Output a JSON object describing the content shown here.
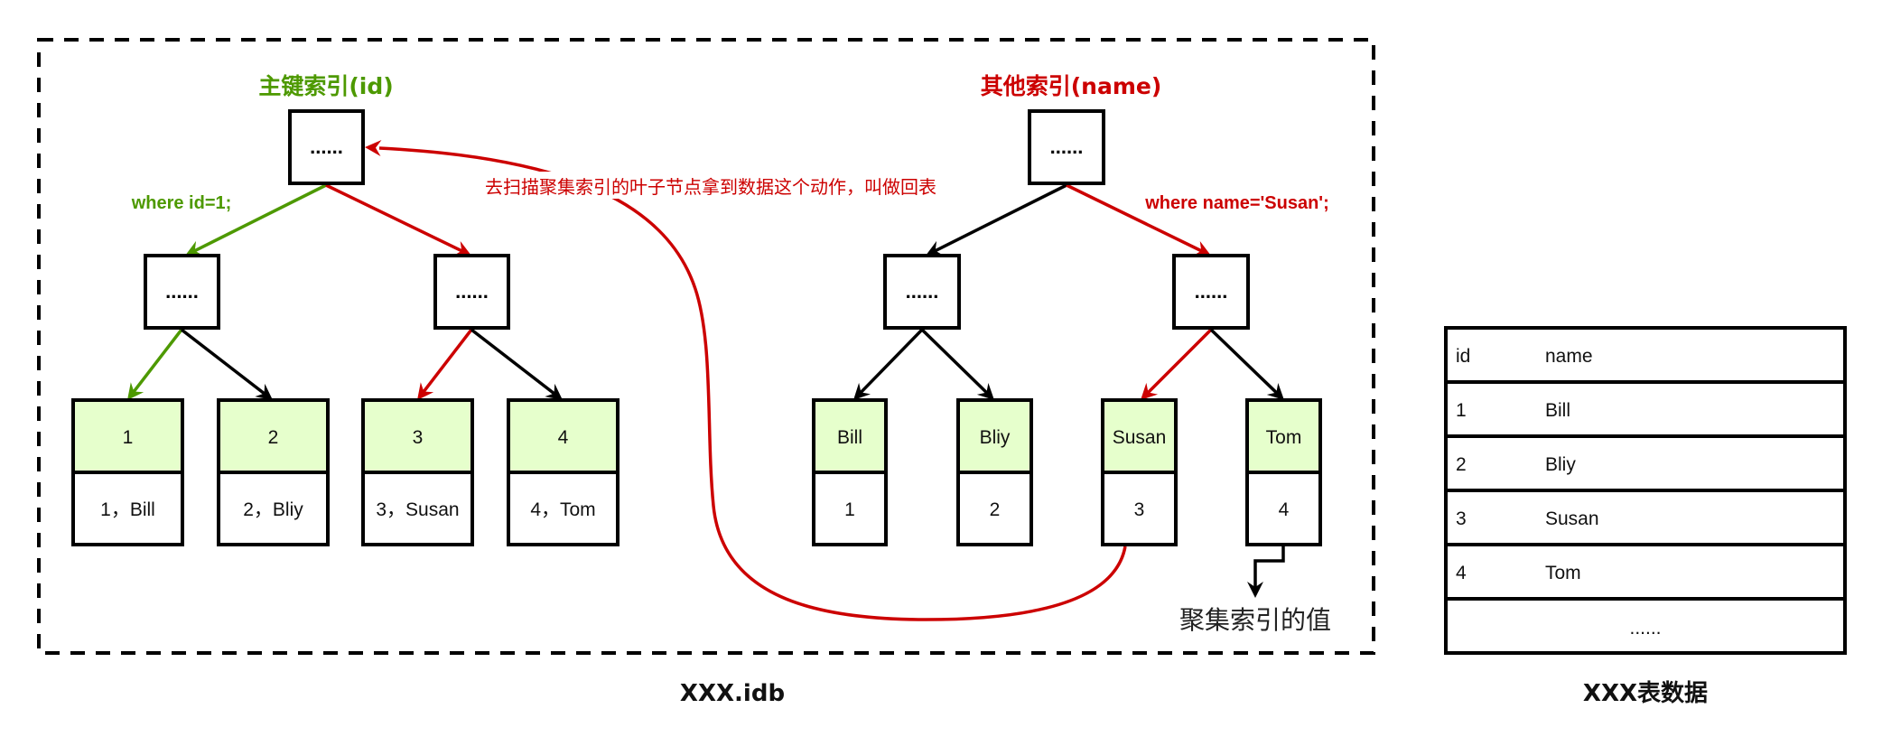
{
  "colors": {
    "green": "#4D9900",
    "red": "#CC0000",
    "black": "#000000",
    "leaf_fill": "#E6FFCC"
  },
  "container": {
    "caption": "XXX.idb"
  },
  "primary_index": {
    "title": "主键索引(id)",
    "root_label": "......",
    "condition": "where id=1;",
    "internal_nodes": [
      {
        "label": "......"
      },
      {
        "label": "......"
      }
    ],
    "leaves": [
      {
        "key": "1",
        "value": "1，Bill"
      },
      {
        "key": "2",
        "value": "2，Bliy"
      },
      {
        "key": "3",
        "value": "3，Susan"
      },
      {
        "key": "4",
        "value": "4，Tom"
      }
    ]
  },
  "secondary_index": {
    "title": "其他索引(name)",
    "root_label": "......",
    "condition": "where name='Susan';",
    "internal_nodes": [
      {
        "label": "......"
      },
      {
        "label": "......"
      }
    ],
    "leaves": [
      {
        "key": "Bill",
        "value": "1"
      },
      {
        "key": "Bliy",
        "value": "2"
      },
      {
        "key": "Susan",
        "value": "3"
      },
      {
        "key": "Tom",
        "value": "4"
      }
    ]
  },
  "annotations": {
    "back_to_table": "去扫描聚集索引的叶子节点拿到数据这个动作，叫做回表",
    "clustered_value": "聚集索引的值"
  },
  "table": {
    "caption": "XXX表数据",
    "headers": [
      "id",
      "name"
    ],
    "rows": [
      [
        "1",
        "Bill"
      ],
      [
        "2",
        "Bliy"
      ],
      [
        "3",
        "Susan"
      ],
      [
        "4",
        "Tom"
      ]
    ],
    "more": "......"
  }
}
